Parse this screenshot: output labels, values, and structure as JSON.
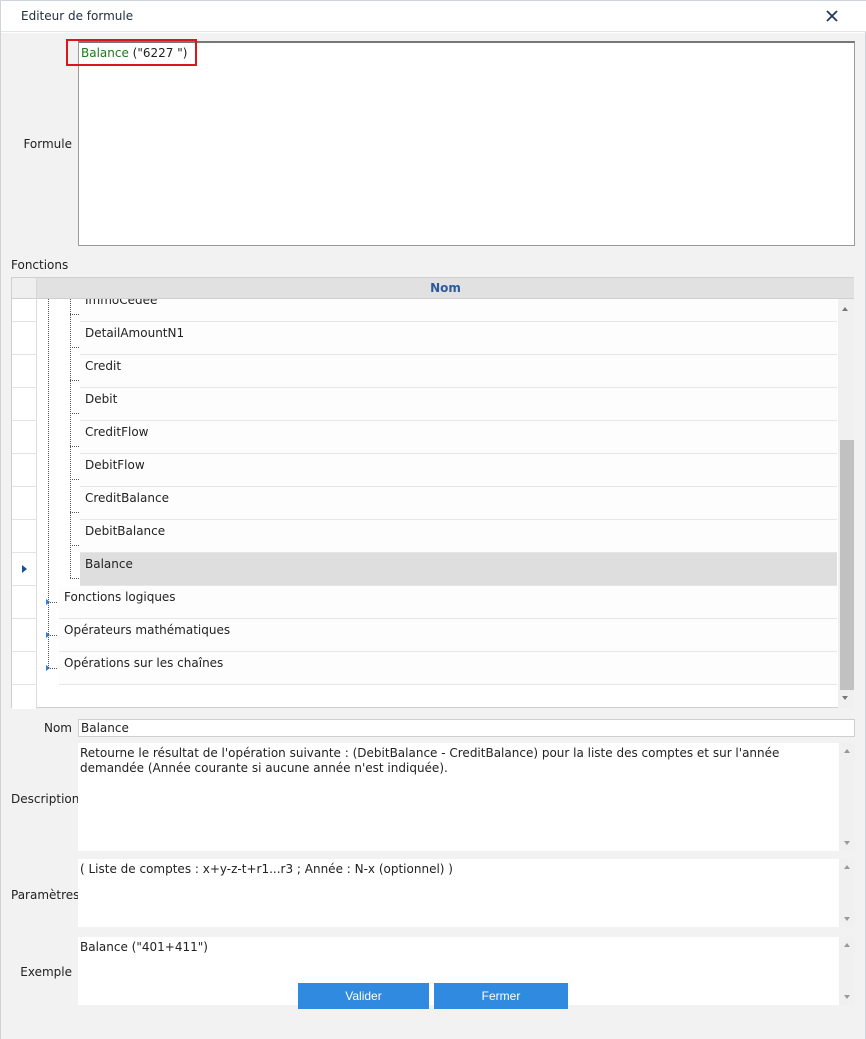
{
  "window": {
    "title": "Editeur de formule"
  },
  "formula": {
    "label": "Formule",
    "function_name": "Balance",
    "arguments": " (\"6227 \")"
  },
  "functions": {
    "label": "Fonctions",
    "column_header": "Nom",
    "rows": [
      {
        "text": "ImmoCedee",
        "level": 1,
        "selected": false
      },
      {
        "text": "DetailAmountN1",
        "level": 1,
        "selected": false
      },
      {
        "text": "Credit",
        "level": 1,
        "selected": false
      },
      {
        "text": "Debit",
        "level": 1,
        "selected": false
      },
      {
        "text": "CreditFlow",
        "level": 1,
        "selected": false
      },
      {
        "text": "DebitFlow",
        "level": 1,
        "selected": false
      },
      {
        "text": "CreditBalance",
        "level": 1,
        "selected": false
      },
      {
        "text": "DebitBalance",
        "level": 1,
        "selected": false
      },
      {
        "text": "Balance",
        "level": 1,
        "selected": true
      },
      {
        "text": "Fonctions logiques",
        "level": 0,
        "selected": false
      },
      {
        "text": "Opérateurs mathématiques",
        "level": 0,
        "selected": false
      },
      {
        "text": "Opérations sur les chaînes",
        "level": 0,
        "selected": false
      }
    ]
  },
  "details": {
    "name_label": "Nom",
    "name_value": "Balance",
    "description_label": "Description",
    "description_value": "Retourne le résultat de l'opération suivante : (DebitBalance - CreditBalance) pour la liste des comptes et sur l'année demandée (Année courante si aucune année n'est indiquée).",
    "parameters_label": "Paramètres",
    "parameters_value": "( Liste de comptes : x+y-z-t+r1...r3 ; Année : N-x (optionnel) )",
    "example_label": "Exemple",
    "example_value": "Balance (\"401+411\")"
  },
  "buttons": {
    "validate": "Valider",
    "close": "Fermer"
  },
  "colors": {
    "accent": "#2f8ae0",
    "function_name": "#1b7a1b",
    "highlight_border": "#d9171d",
    "header_text": "#2d5a9a"
  }
}
